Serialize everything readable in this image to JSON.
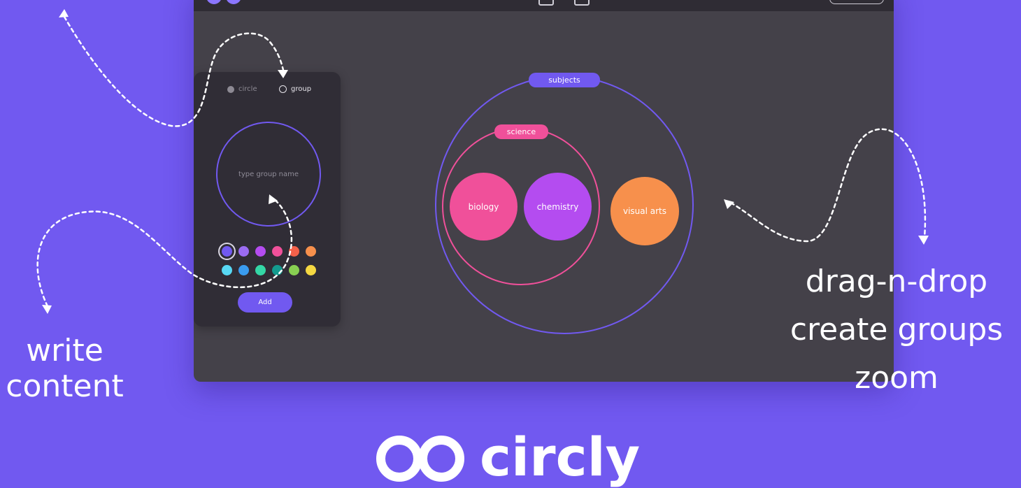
{
  "brand": {
    "name": "circly"
  },
  "panel": {
    "radio_options": [
      {
        "label": "circle",
        "selected": false
      },
      {
        "label": "group",
        "selected": true
      }
    ],
    "name_input_placeholder": "type group name",
    "colors": [
      "#7159f0",
      "#9b6cf2",
      "#b44cf0",
      "#f0509a",
      "#f4614a",
      "#f7904c",
      "#58d8f4",
      "#3a9cf0",
      "#34d7a6",
      "#139a8e",
      "#88d052",
      "#f5d842"
    ],
    "selected_color_index": 0,
    "add_button_label": "Add"
  },
  "canvas": {
    "groups": [
      {
        "label": "subjects",
        "color": "#7159f0"
      },
      {
        "label": "science",
        "color": "#f0509a"
      }
    ],
    "circles": [
      {
        "label": "biology",
        "color": "#f0509a"
      },
      {
        "label": "chemistry",
        "color": "#b44cf0"
      },
      {
        "label": "visual arts",
        "color": "#f7904c"
      }
    ]
  },
  "captions": {
    "left": [
      "write",
      "content"
    ],
    "right": [
      "drag-n-drop",
      "create groups",
      "zoom"
    ]
  }
}
